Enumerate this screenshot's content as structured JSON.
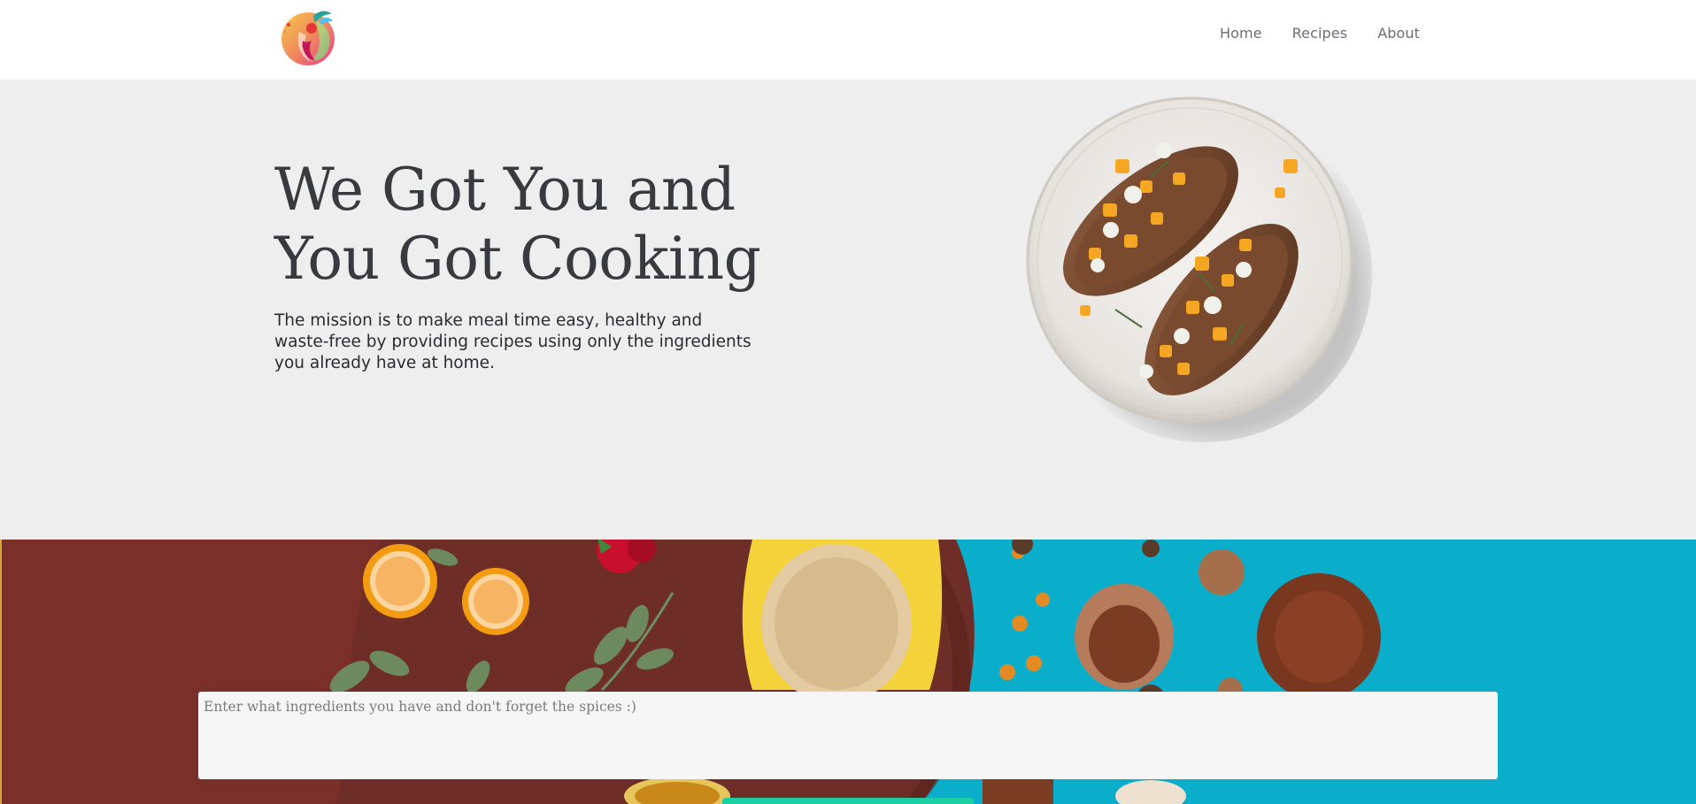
{
  "nav": {
    "logo_icon": "fruit-drop-logo",
    "links": [
      {
        "label": "Home"
      },
      {
        "label": "Recipes"
      },
      {
        "label": "About"
      }
    ]
  },
  "hero": {
    "title": "We Got You and You Got Cooking",
    "description": "The mission is to make meal time easy, healthy and waste-free by providing recipes using only the ingredients you already have at home.",
    "image": "plate-with-toasts"
  },
  "search": {
    "background_image": "ingredients-flat-lay",
    "placeholder": "Enter what ingredients you have and don't forget the spices :)",
    "value": "",
    "button_label": ""
  },
  "colors": {
    "hero_bg": "#eeeeee",
    "nav_text": "#6b6e75",
    "title_text": "#383a40",
    "brown_bg": "#6e2e27",
    "teal_bg": "#0aaecb",
    "button_accent": "#1ccfa3"
  }
}
